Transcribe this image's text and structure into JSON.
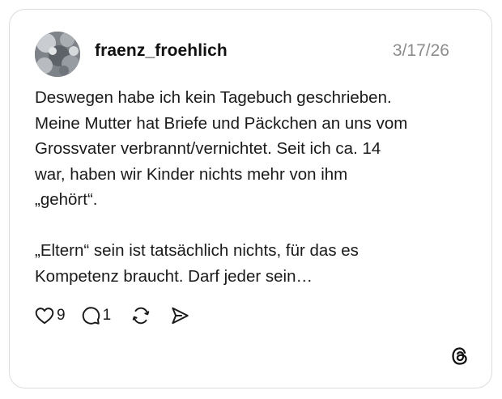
{
  "post": {
    "username": "fraenz_froehlich",
    "date": "3/17/26",
    "text": "Deswegen habe ich kein Tagebuch geschrieben.\nMeine Mutter hat Briefe und Päckchen an uns vom\nGrossvater verbrannt/vernichtet. Seit ich ca. 14\nwar, haben wir Kinder nichts mehr von ihm\n„gehört“.\n\n„Eltern“ sein ist tatsächlich nichts, für das es\nKompetenz braucht. Darf jeder sein…"
  },
  "actions": {
    "like": {
      "icon": "heart-icon",
      "count": "9"
    },
    "reply": {
      "icon": "comment-icon",
      "count": "1"
    },
    "repost": {
      "icon": "repost-icon"
    },
    "share": {
      "icon": "send-icon"
    }
  },
  "brand": {
    "icon": "threads-logo-icon"
  },
  "colors": {
    "text": "#1a1a1a",
    "muted": "#8c8c8c",
    "border": "#dcdcdc"
  }
}
